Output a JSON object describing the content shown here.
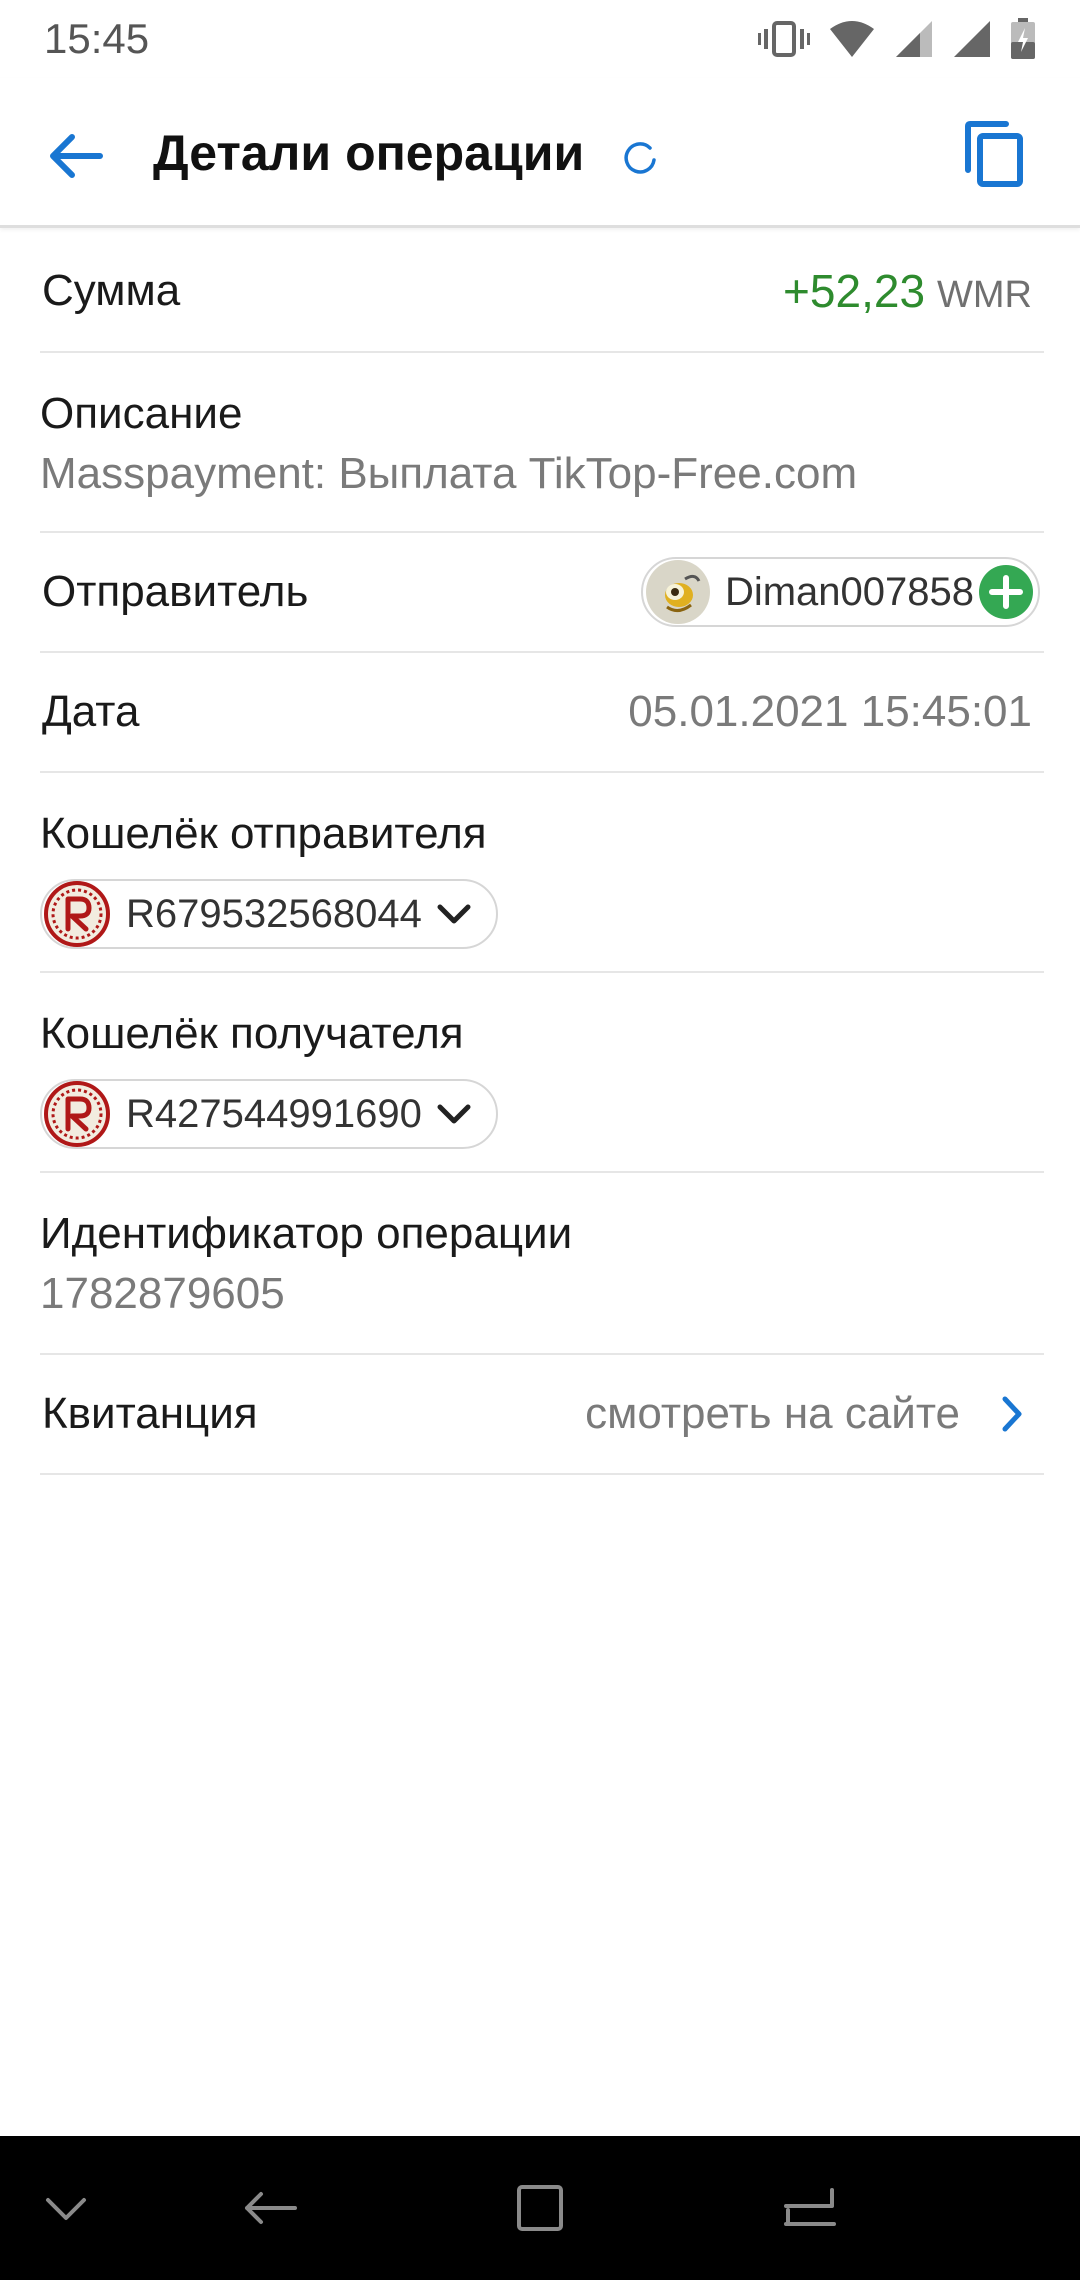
{
  "status_bar": {
    "time": "15:45"
  },
  "app_bar": {
    "title": "Детали операции"
  },
  "rows": {
    "sum": {
      "label": "Сумма",
      "amount": "+52,23",
      "currency": "WMR",
      "amount_color": "#2e8b2e"
    },
    "description": {
      "label": "Описание",
      "value": "Masspayment: Выплата TikTop-Free.com"
    },
    "sender": {
      "label": "Отправитель",
      "name": "Diman007858"
    },
    "date": {
      "label": "Дата",
      "value": "05.01.2021 15:45:01"
    },
    "sender_wallet": {
      "label": "Кошелёк отправителя",
      "number": "R679532568044"
    },
    "receiver_wallet": {
      "label": "Кошелёк получателя",
      "number": "R427544991690"
    },
    "operation_id": {
      "label": "Идентификатор операции",
      "value": "1782879605"
    },
    "receipt": {
      "label": "Квитанция",
      "link_text": "смотреть на сайте"
    }
  },
  "colors": {
    "accent": "#1976d2",
    "add": "#34a853"
  },
  "icons": [
    "back-arrow-icon",
    "refresh-spinner-icon",
    "copy-icon",
    "avatar-icon",
    "add-contact-icon",
    "wmr-wallet-icon",
    "chevron-down-icon",
    "chevron-right-icon"
  ]
}
